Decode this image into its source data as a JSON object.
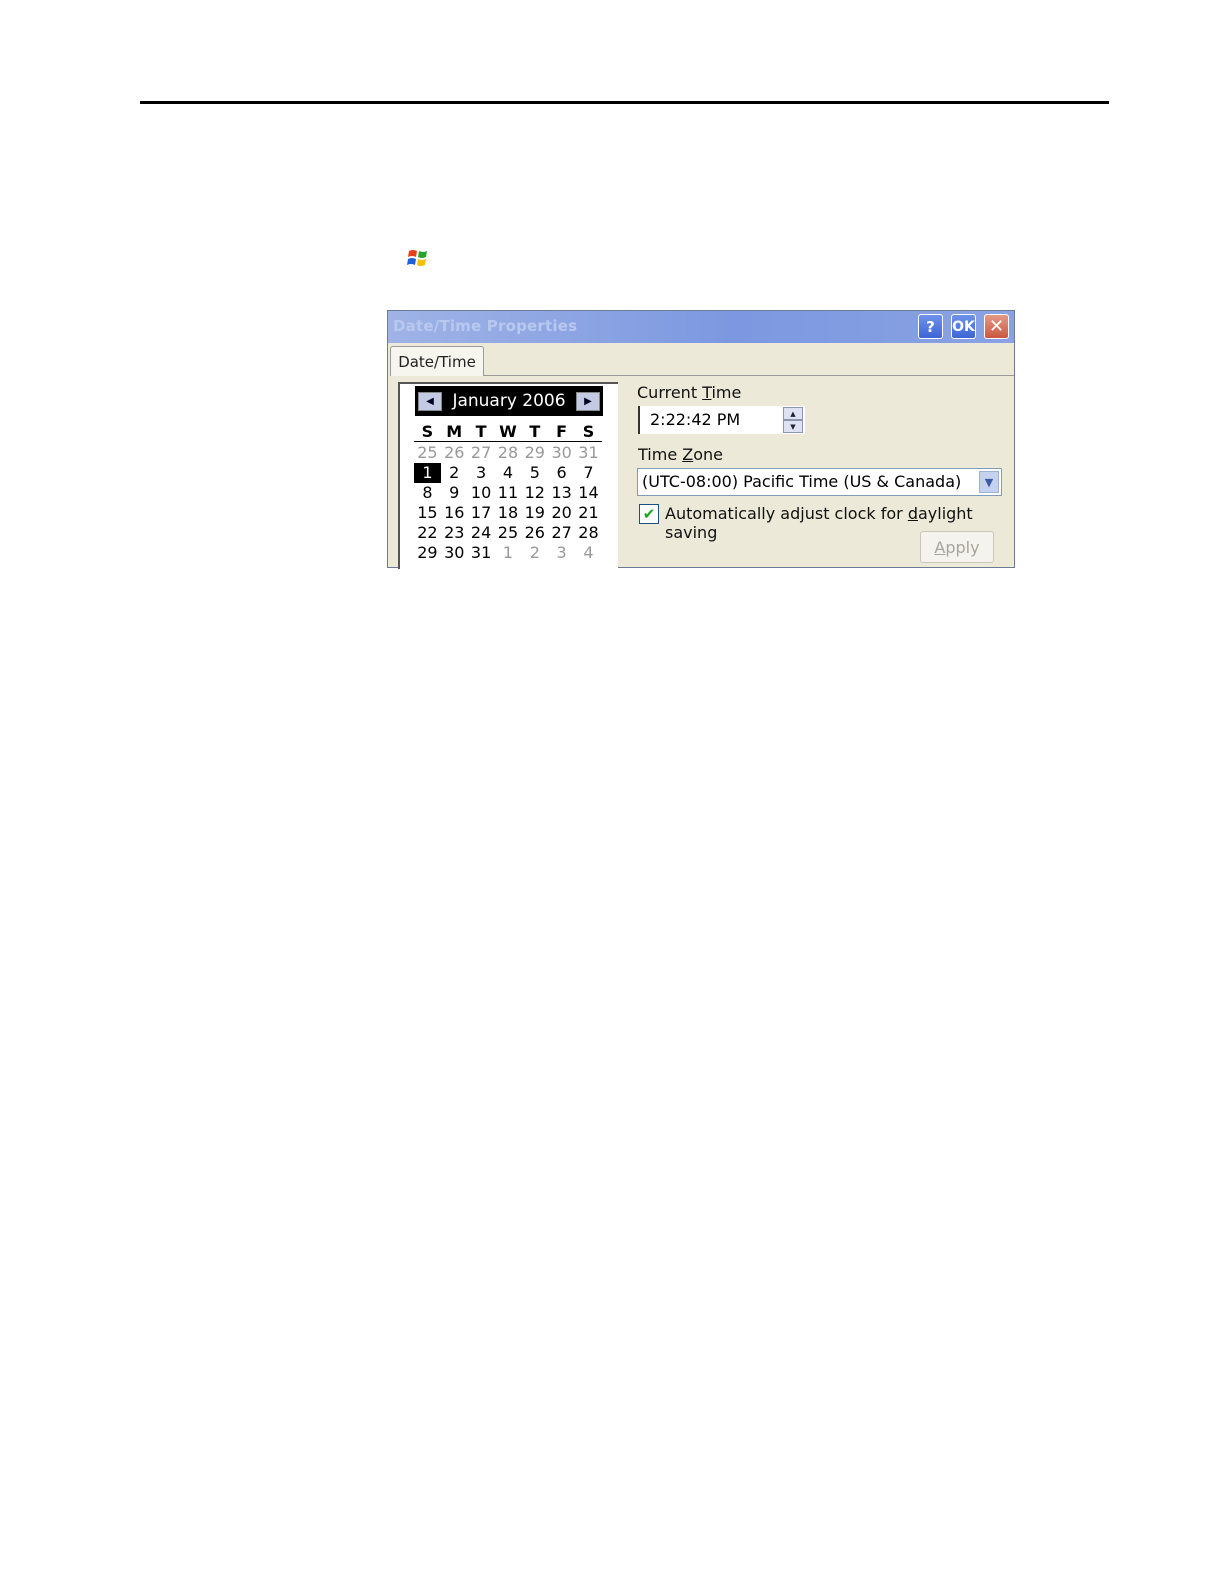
{
  "dialog": {
    "title": "Date/Time Properties",
    "help_label": "?",
    "ok_label": "OK",
    "close_label": "✕",
    "tab_label": "Date/Time"
  },
  "calendar": {
    "month_year": "January 2006",
    "days_of_week": [
      "S",
      "M",
      "T",
      "W",
      "T",
      "F",
      "S"
    ],
    "weeks": [
      [
        "25",
        "26",
        "27",
        "28",
        "29",
        "30",
        "31"
      ],
      [
        "1",
        "2",
        "3",
        "4",
        "5",
        "6",
        "7"
      ],
      [
        "8",
        "9",
        "10",
        "11",
        "12",
        "13",
        "14"
      ],
      [
        "15",
        "16",
        "17",
        "18",
        "19",
        "20",
        "21"
      ],
      [
        "22",
        "23",
        "24",
        "25",
        "26",
        "27",
        "28"
      ],
      [
        "29",
        "30",
        "31",
        "1",
        "2",
        "3",
        "4"
      ]
    ],
    "selected_day": "1"
  },
  "current_time": {
    "label_pre": "Current ",
    "label_accel": "T",
    "label_post": "ime",
    "value": "2:22:42 PM"
  },
  "time_zone": {
    "label_pre": "Time ",
    "label_accel": "Z",
    "label_post": "one",
    "value": "(UTC-08:00) Pacific Time (US & Canada)"
  },
  "daylight": {
    "checked": true,
    "label_pre": "Automatically adjust clock for ",
    "label_accel": "d",
    "label_post": "aylight saving"
  },
  "apply": {
    "label_accel": "A",
    "label_post": "pply"
  }
}
